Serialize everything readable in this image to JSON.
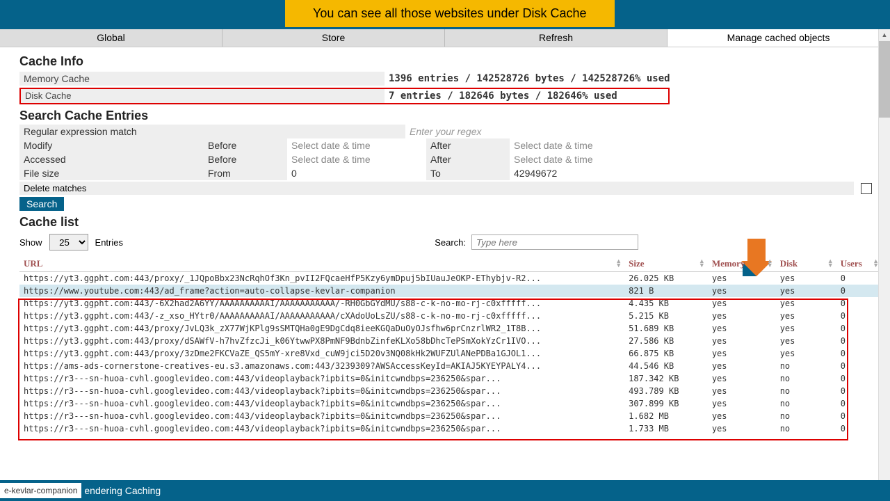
{
  "annotation": "You can see all those websites under Disk Cache",
  "tabs": [
    "Global",
    "Store",
    "Refresh",
    "Manage cached objects"
  ],
  "activeTab": 3,
  "cache_info": {
    "heading": "Cache Info",
    "memory_label": "Memory Cache",
    "memory_value": "1396 entries / 142528726 bytes / 142528726% used",
    "disk_label": "Disk Cache",
    "disk_value": "7 entries / 182646 bytes / 182646% used"
  },
  "search_entries": {
    "heading": "Search Cache Entries",
    "regex_label": "Regular expression match",
    "regex_placeholder": "Enter your regex",
    "modify": "Modify",
    "accessed": "Accessed",
    "file_size": "File size",
    "before": "Before",
    "after": "After",
    "from": "From",
    "to": "To",
    "select_dt": "Select date & time",
    "fs_from": "0",
    "fs_to": "42949672",
    "delete_label": "Delete matches",
    "search_btn": "Search"
  },
  "cache_list": {
    "heading": "Cache list",
    "show": "Show",
    "entries": "Entries",
    "show_val": "25",
    "search_label": "Search:",
    "search_placeholder": "Type here",
    "cols": {
      "url": "URL",
      "size": "Size",
      "memory": "Memory",
      "disk": "Disk",
      "users": "Users"
    },
    "rows": [
      {
        "url": "https://yt3.ggpht.com:443/proxy/_1JQpoBbx23NcRqhOf3Kn_pvII2FQcaeHfP5Kzy6ymDpuj5bIUauJeOKP-EThybjv-R2...",
        "size": "26.025 KB",
        "mem": "yes",
        "disk": "yes",
        "users": "0",
        "hl": false
      },
      {
        "url": "https://www.youtube.com:443/ad_frame?action=auto-collapse-kevlar-companion",
        "size": "821 B",
        "mem": "yes",
        "disk": "yes",
        "users": "0",
        "hl": true
      },
      {
        "url": "https://yt3.ggpht.com:443/-6X2had2A6YY/AAAAAAAAAAI/AAAAAAAAAAA/-RH0GbGYdMU/s88-c-k-no-mo-rj-c0xfffff...",
        "size": "4.435 KB",
        "mem": "yes",
        "disk": "yes",
        "users": "0",
        "hl": false
      },
      {
        "url": "https://yt3.ggpht.com:443/-z_xso_HYtr0/AAAAAAAAAAI/AAAAAAAAAAA/cXAdoUoLsZU/s88-c-k-no-mo-rj-c0xfffff...",
        "size": "5.215 KB",
        "mem": "yes",
        "disk": "yes",
        "users": "0",
        "hl": false
      },
      {
        "url": "https://yt3.ggpht.com:443/proxy/JvLQ3k_zX77WjKPlg9sSMTQHa0gE9DgCdq8ieeKGQaDuOyOJsfhw6prCnzrlWR2_1T8B...",
        "size": "51.689 KB",
        "mem": "yes",
        "disk": "yes",
        "users": "0",
        "hl": false
      },
      {
        "url": "https://yt3.ggpht.com:443/proxy/dSAWfV-h7hvZfzcJi_k06YtwwPX8PmNF9BdnbZinfeKLXo58bDhcTePSmXokYzCr1IVO...",
        "size": "27.586 KB",
        "mem": "yes",
        "disk": "yes",
        "users": "0",
        "hl": false
      },
      {
        "url": "https://yt3.ggpht.com:443/proxy/3zDme2FKCVaZE_QS5mY-xre8Vxd_cuW9jci5D20v3NQ08kHk2WUFZUlANePDBa1GJOL1...",
        "size": "66.875 KB",
        "mem": "yes",
        "disk": "yes",
        "users": "0",
        "hl": false
      },
      {
        "url": "https://ams-ads-cornerstone-creatives-eu.s3.amazonaws.com:443/3239309?AWSAccessKeyId=AKIAJ5KYEYPALY4...",
        "size": "44.546 KB",
        "mem": "yes",
        "disk": "no",
        "users": "0",
        "hl": false
      },
      {
        "url": "https://r3---sn-huoa-cvhl.googlevideo.com:443/videoplayback?ipbits=0&initcwndbps=236250&spar...",
        "size": "187.342 KB",
        "mem": "yes",
        "disk": "no",
        "users": "0",
        "hl": false
      },
      {
        "url": "https://r3---sn-huoa-cvhl.googlevideo.com:443/videoplayback?ipbits=0&initcwndbps=236250&spar...",
        "size": "493.789 KB",
        "mem": "yes",
        "disk": "no",
        "users": "0",
        "hl": false
      },
      {
        "url": "https://r3---sn-huoa-cvhl.googlevideo.com:443/videoplayback?ipbits=0&initcwndbps=236250&spar...",
        "size": "307.899 KB",
        "mem": "yes",
        "disk": "no",
        "users": "0",
        "hl": false
      },
      {
        "url": "https://r3---sn-huoa-cvhl.googlevideo.com:443/videoplayback?ipbits=0&initcwndbps=236250&spar...",
        "size": "1.682 MB",
        "mem": "yes",
        "disk": "no",
        "users": "0",
        "hl": false
      },
      {
        "url": "https://r3---sn-huoa-cvhl.googlevideo.com:443/videoplayback?ipbits=0&initcwndbps=236250&spar...",
        "size": "1.733 MB",
        "mem": "yes",
        "disk": "no",
        "users": "0",
        "hl": false
      }
    ]
  },
  "footer": {
    "tag": "e-kevlar-companion",
    "text": "endering Caching"
  }
}
